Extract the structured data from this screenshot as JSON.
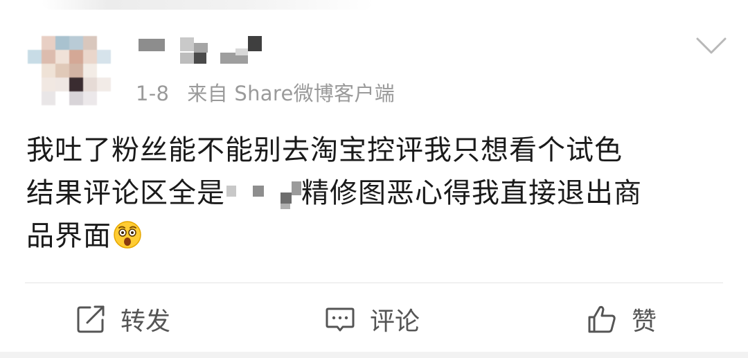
{
  "post": {
    "time": "1-8",
    "source": "来自 Share微博客户端",
    "content": {
      "line1": "我吐了粉丝能不能别去淘宝控评我只想看个试色",
      "line2_pre": "结果评论区全是",
      "line2_post": "精修图恶心得我直接退出商",
      "line3": "品界面"
    },
    "emoji_icon": "astonished-face-emoji"
  },
  "actions": {
    "repost_label": "转发",
    "comment_label": "评论",
    "like_label": "赞"
  },
  "icons": {
    "dropdown": "chevron-down-icon",
    "repost": "share-square-arrow-icon",
    "comment": "comment-bubble-icon",
    "like": "thumbs-up-icon"
  },
  "colors": {
    "text": "#1a1a1a",
    "meta": "#9a9a9a",
    "action_text": "#555555",
    "divider": "#e4e4e4"
  }
}
